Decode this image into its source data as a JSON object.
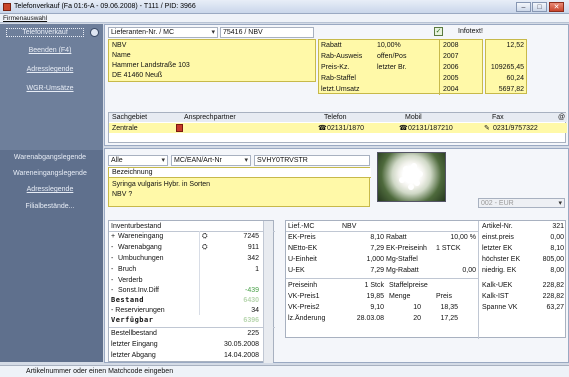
{
  "window": {
    "title": "Telefonverkauf (Fa 01:6-A - 09.06.2008) - T111 / PID: 3966"
  },
  "menu": {
    "item": "Firmenauswahl"
  },
  "sidebar": {
    "top_items": [
      {
        "label": "Telefonverkauf"
      },
      {
        "label": "Beenden  (F4)"
      },
      {
        "label": "Adresslegende"
      },
      {
        "label": "WGR-Umsätze"
      }
    ],
    "bottom_items": [
      {
        "label": "Warenabgangslegende"
      },
      {
        "label": "Wareneingangslegende"
      },
      {
        "label": "Adresslegende"
      },
      {
        "label": "Filialbestände..."
      }
    ]
  },
  "lieferant": {
    "dropdown": "Lieferanten-Nr. / MC",
    "value": "75416 / NBV",
    "lines": [
      "NBV",
      "Name",
      "Hammer Landstraße 103",
      "DE 41460 Neuß"
    ],
    "infotext_label": "Infotext!",
    "infotext_checked": true
  },
  "rabatt_table": [
    {
      "label": "Rabatt",
      "val": "10,00%",
      "year": "2008",
      "amount": "12,52"
    },
    {
      "label": "Rab-Ausweis",
      "val": "offen/Pos",
      "year": "2007",
      "amount": ""
    },
    {
      "label": "Preis-Kz.",
      "val": "letzter Br.",
      "year": "2006",
      "amount": "109265,45"
    },
    {
      "label": "Rab-Staffel",
      "val": "",
      "year": "2005",
      "amount": "60,24"
    },
    {
      "label": "letzt.Umsatz",
      "val": "",
      "year": "2004",
      "amount": "5697,82"
    }
  ],
  "contact": {
    "headers": [
      "Sachgebiet",
      "Ansprechpartner",
      "Telefon",
      "Mobil",
      "Fax"
    ],
    "row": {
      "sachgebiet": "Zentrale",
      "ansprechpartner": "",
      "telefon": "02131/1870",
      "mobil": "02131/187210",
      "fax": "0231/9757322"
    }
  },
  "article_search": {
    "filter": "Alle",
    "mode": "MC/EAN/Art-Nr",
    "value": "SVHY0TRVSTR",
    "bezeichnung_label": "Bezeichnung",
    "lines": [
      "Syringa vulgaris Hybr. in Sorten",
      "NBV ?"
    ],
    "currency": "002 - EUR"
  },
  "inventory": {
    "header": "Inventurbestand",
    "rows": [
      {
        "sign": "+",
        "label": "Wareneingang",
        "value": "7245",
        "binoc": true
      },
      {
        "sign": "-",
        "label": "Warenabgang",
        "value": "911",
        "binoc": true
      },
      {
        "sign": "-",
        "label": "Umbuchungen",
        "value": "342",
        "binoc": false
      },
      {
        "sign": "-",
        "label": "Bruch",
        "value": "1",
        "binoc": false
      },
      {
        "sign": "-",
        "label": "Verderb",
        "value": "",
        "binoc": false
      },
      {
        "sign": "-",
        "label": "Sonst.Inv.Diff",
        "value": "-439",
        "binoc": false
      }
    ],
    "bestand_label": "Bestand",
    "bestand_value": "6430",
    "reserv_label": "- Reservierungen",
    "reserv_value": "34",
    "verfuegbar_label": "Verfügbar",
    "verfuegbar_value": "6396",
    "bottom": [
      {
        "label": "Bestellbestand",
        "value": "225"
      },
      {
        "label": "letzter Eingang",
        "value": "30.05.2008"
      },
      {
        "label": "letzter Abgang",
        "value": "14.04.2008"
      }
    ]
  },
  "pricing": {
    "lief_label": "Lief.-MC",
    "lief_value": "NBV",
    "rows": [
      {
        "label": "EK-Preis",
        "value": "8,10",
        "label2": "Rabatt",
        "value2": "10,00 %"
      },
      {
        "label": "NEtto-EK",
        "value": "7,29",
        "label2": "EK-Preiseinh",
        "value2": "1 STCK"
      },
      {
        "label": "U-Einheit",
        "value": "1,000",
        "label2": "Mg-Staffel",
        "value2": ""
      },
      {
        "label": "U-EK",
        "value": "7,29",
        "label2": "Mg-Rabatt",
        "value2": "0,00"
      }
    ],
    "preiseinh_label": "Preiseinh",
    "preiseinh_value": "1 Stck",
    "staffelpreise_label": "Staffelpreise",
    "vk_rows": [
      {
        "label": "VK-Preis1",
        "value": "19,85",
        "c2": "Menge",
        "c3": "Preis"
      },
      {
        "label": "VK-Preis2",
        "value": "9,10",
        "c2": "10",
        "c3": "18,35"
      },
      {
        "label": "lz.Änderung",
        "value": "28.03.08",
        "c2": "20",
        "c3": "17,25"
      }
    ],
    "article_col": [
      {
        "label": "Artikel-Nr.",
        "value": "321"
      },
      {
        "label": "einst.preis",
        "value": "0,00"
      },
      {
        "label": "letzter EK",
        "value": "8,10"
      },
      {
        "label": "höchster EK",
        "value": "805,00"
      },
      {
        "label": "niedrig. EK",
        "value": "8,00"
      }
    ],
    "kalk": [
      {
        "label": "Kalk-UEK",
        "value": "228,82"
      },
      {
        "label": "Kalk-IST",
        "value": "228,82"
      },
      {
        "label": "Spanne VK",
        "value": "63,27"
      }
    ]
  },
  "status": {
    "text": "Artikelnummer oder einen Matchcode eingeben"
  }
}
